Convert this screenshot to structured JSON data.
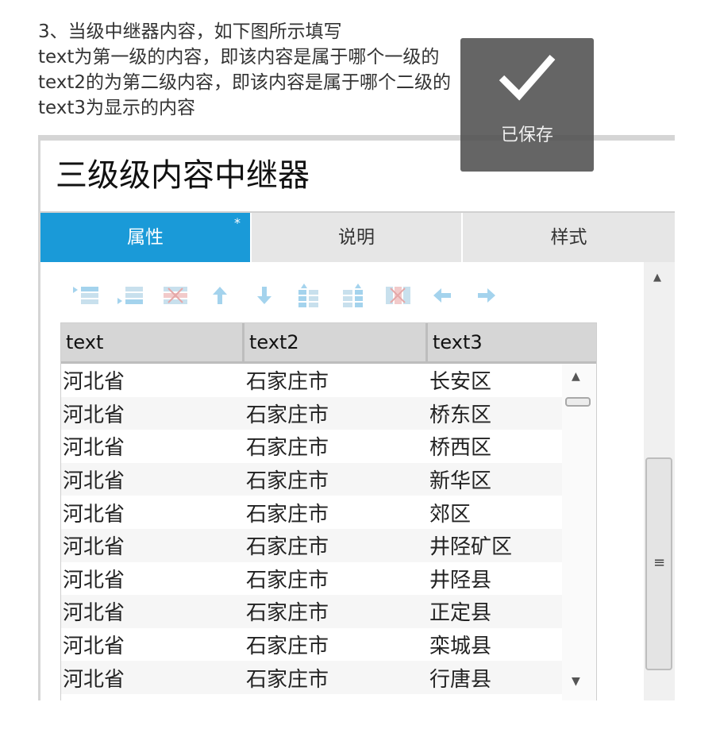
{
  "instructions": {
    "line1": "3、当级中继器内容，如下图所示填写",
    "line2": "text为第一级的内容，即该内容是属于哪个一级的",
    "line3": "text2的为第二级内容，即该内容是属于哪个二级的",
    "line4": "text3为显示的内容"
  },
  "panel": {
    "title": "三级级内容中继器",
    "tabs": [
      {
        "label": "属性",
        "active": true,
        "dirty": "*"
      },
      {
        "label": "说明",
        "active": false
      },
      {
        "label": "样式",
        "active": false
      }
    ],
    "accent_color": "#1a9ad8"
  },
  "toolbar": {
    "icons": [
      "insert-row-above-icon",
      "insert-row-below-icon",
      "delete-row-icon",
      "move-up-icon",
      "move-down-icon",
      "insert-column-left-icon",
      "insert-column-right-icon",
      "delete-column-icon",
      "move-left-icon",
      "move-right-icon"
    ]
  },
  "grid": {
    "columns": [
      "text",
      "text2",
      "text3"
    ],
    "rows": [
      [
        "河北省",
        "石家庄市",
        "长安区"
      ],
      [
        "河北省",
        "石家庄市",
        "桥东区"
      ],
      [
        "河北省",
        "石家庄市",
        "桥西区"
      ],
      [
        "河北省",
        "石家庄市",
        "新华区"
      ],
      [
        "河北省",
        "石家庄市",
        "郊区"
      ],
      [
        "河北省",
        "石家庄市",
        "井陉矿区"
      ],
      [
        "河北省",
        "石家庄市",
        "井陉县"
      ],
      [
        "河北省",
        "石家庄市",
        "正定县"
      ],
      [
        "河北省",
        "石家庄市",
        "栾城县"
      ],
      [
        "河北省",
        "石家庄市",
        "行唐县"
      ]
    ]
  },
  "toast": {
    "message": "已保存",
    "icon": "checkmark-icon"
  }
}
